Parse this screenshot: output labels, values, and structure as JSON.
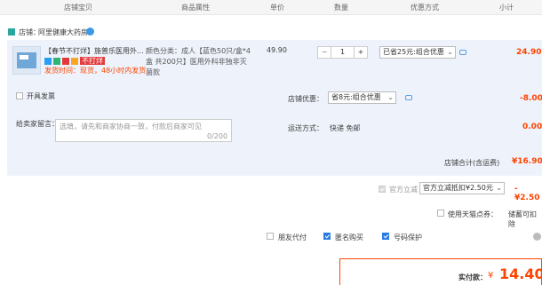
{
  "header": {
    "col_shop_item": "店铺宝贝",
    "col_attrs": "商品属性",
    "col_unit_price": "单价",
    "col_qty": "数量",
    "col_discount": "优惠方式",
    "col_subtotal": "小计"
  },
  "shop": {
    "label": "店铺：",
    "name": "阿里健康大药房"
  },
  "item": {
    "title": "【春节不打烊】施普乐医用外...",
    "red_tag": "不打烊",
    "ship_note": "发货时间：现货，48小时内发货",
    "attrs_line1": "颜色分类：成人【蓝色50只/盒*4",
    "attrs_line2": "盒 共200只】医用外科非独非灭",
    "attrs_line3": "菌款",
    "unit_price": "49.90",
    "qty": "1",
    "discount_select": "已省25元:组合优惠",
    "subtotal": "24.90"
  },
  "invoice": {
    "label": "开具发票"
  },
  "shop_discount": {
    "label": "店铺优惠：",
    "select": "省8元:组合优惠",
    "amount": "-8.00"
  },
  "message": {
    "label": "给卖家留言：",
    "placeholder": "选填，请先和商家协商一致，付款后商家可见",
    "counter": "0/200"
  },
  "shipping": {
    "label": "运送方式：",
    "value": "快递 免邮",
    "amount": "0.00"
  },
  "shop_total": {
    "label": "店铺合计(含运费)",
    "amount": "¥16.90"
  },
  "official_discount": {
    "label": "官方立减",
    "select": "官方立减抵扣¥2.50元",
    "amount": "-¥2.50"
  },
  "tmall_points": {
    "label": "使用天猫点券：",
    "note": "储蓄可扣除"
  },
  "options": {
    "friend_pay": "朋友代付",
    "anonymous": "匿名购买",
    "other": "号码保护"
  },
  "actual_pay": {
    "label": "实付款：",
    "currency": "¥",
    "amount": "14.40"
  },
  "colors": {
    "accent_red": "#ff4400",
    "checkbox_blue": "#2c7be5",
    "row_bg": "#eef3fb"
  }
}
